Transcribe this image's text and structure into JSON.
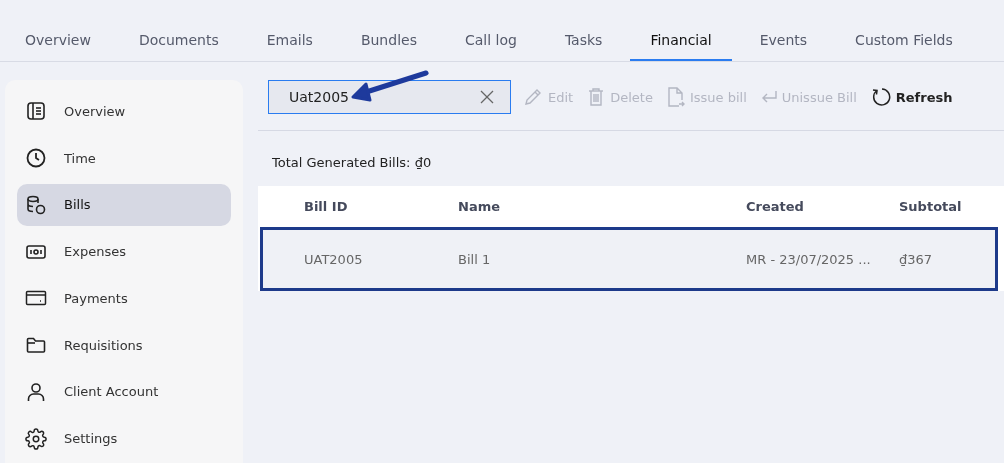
{
  "tabs": [
    {
      "label": "Overview",
      "selected": false
    },
    {
      "label": "Documents",
      "selected": false
    },
    {
      "label": "Emails",
      "selected": false
    },
    {
      "label": "Bundles",
      "selected": false
    },
    {
      "label": "Call log",
      "selected": false
    },
    {
      "label": "Tasks",
      "selected": false
    },
    {
      "label": "Financial",
      "selected": true
    },
    {
      "label": "Events",
      "selected": false
    },
    {
      "label": "Custom Fields",
      "selected": false
    }
  ],
  "sidebar": {
    "items": [
      {
        "label": "Overview",
        "kind": "overview",
        "selected": false
      },
      {
        "label": "Time",
        "kind": "time",
        "selected": false
      },
      {
        "label": "Bills",
        "kind": "bills",
        "selected": true
      },
      {
        "label": "Expenses",
        "kind": "expenses",
        "selected": false
      },
      {
        "label": "Payments",
        "kind": "payments",
        "selected": false
      },
      {
        "label": "Requisitions",
        "kind": "requisitions",
        "selected": false
      },
      {
        "label": "Client Account",
        "kind": "client",
        "selected": false
      },
      {
        "label": "Settings",
        "kind": "settings",
        "selected": false
      }
    ]
  },
  "search": {
    "value": "Uat2005"
  },
  "toolbar": [
    {
      "label": "Edit",
      "kind": "edit",
      "disabled": true
    },
    {
      "label": "Delete",
      "kind": "delete",
      "disabled": true
    },
    {
      "label": "Issue bill",
      "kind": "issue",
      "disabled": true
    },
    {
      "label": "Unissue Bill",
      "kind": "unissue",
      "disabled": true
    },
    {
      "label": "Refresh",
      "kind": "refresh",
      "disabled": false
    }
  ],
  "summary": "Total Generated Bills: ₫0",
  "table": {
    "columns": [
      "Bill ID",
      "Name",
      "Created",
      "Subtotal"
    ],
    "rows": [
      {
        "cells": [
          "UAT2005",
          "Bill 1",
          "MR - 23/07/2025 ...",
          "₫367"
        ],
        "selected": true
      }
    ]
  }
}
